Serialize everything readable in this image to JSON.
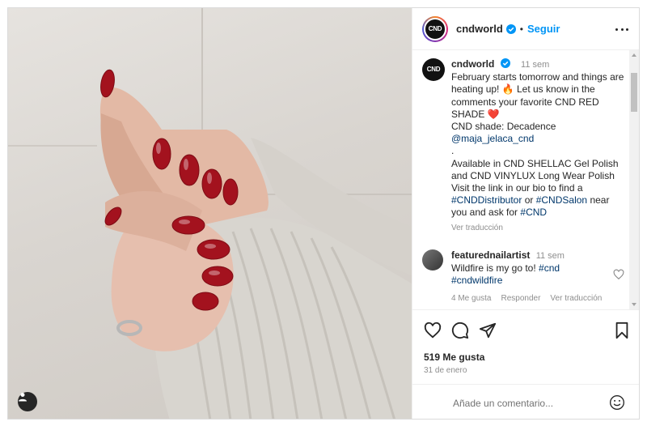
{
  "post": {
    "username": "cndworld",
    "avatar_text": "CND",
    "follow_label": "Seguir",
    "separator": "•"
  },
  "caption": {
    "username": "cndworld",
    "time": "11 sem",
    "line1": "February starts tomorrow and things are heating up! 🔥 Let us know in the comments your favorite CND RED SHADE ❤️",
    "line2": "CND shade: Decadence",
    "mention": "@maja_jelaca_cnd",
    "line3": ".",
    "line4": "Available in CND SHELLAC Gel Polish and CND VINYLUX Long Wear Polish",
    "line5": "Visit the link in our bio to find a",
    "hashtag1": "#CNDDistributor",
    "word_or": "or",
    "hashtag2": "#CNDSalon",
    "line6a": "near you and ask for",
    "hashtag3": "#CND",
    "see_translation": "Ver traducción"
  },
  "comment": {
    "username": "featurednailartist",
    "time": "11 sem",
    "text": "Wildfire is my go to!",
    "hashtag1": "#cnd",
    "hashtag2": "#cndwildfire",
    "likes": "4 Me gusta",
    "reply": "Responder",
    "see_translation": "Ver traducción"
  },
  "stats": {
    "likes": "519 Me gusta",
    "date": "31 de enero"
  },
  "add_comment": {
    "placeholder": "Añade un comentario..."
  },
  "colors": {
    "accent": "#0095f6",
    "link": "#00376b",
    "muted": "#8e8e8e",
    "nail_red": "#a3121e",
    "sweater": "#d9d6d0"
  },
  "icons": [
    "more-icon",
    "verified-icon",
    "heart-icon",
    "comment-icon",
    "share-icon",
    "bookmark-icon",
    "emoji-icon",
    "user-tag-icon"
  ]
}
